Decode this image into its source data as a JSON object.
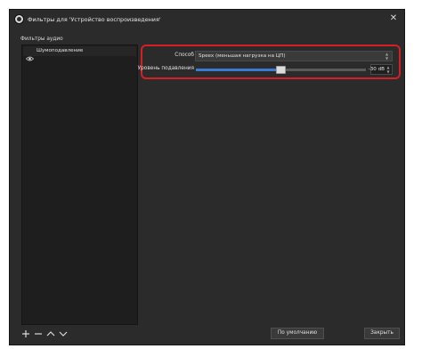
{
  "window": {
    "title": "Фильтры для 'Устройство воспроизведения'",
    "close_glyph": "✕"
  },
  "section_label": "Фильтры аудио",
  "filters": [
    {
      "label": "Шумоподавление",
      "icon": "eye-icon",
      "visible": true
    }
  ],
  "list_toolbar": {
    "add_icon": "plus-icon",
    "remove_icon": "minus-icon",
    "up_icon": "arrow-up-icon",
    "down_icon": "arrow-down-icon"
  },
  "properties": {
    "method_label": "Способ",
    "method_value": "Speex (меньшая нагрузка на ЦП)",
    "suppression_label": "Уровень подавления",
    "suppression_value": "-30 dB",
    "suppression_fraction": 0.5
  },
  "buttons": {
    "defaults": "По умолчанию",
    "close": "Закрыть"
  },
  "colors": {
    "background": "#2b2b2b",
    "highlight": "#d41f26",
    "slider_fill": "#3b7bd6"
  }
}
